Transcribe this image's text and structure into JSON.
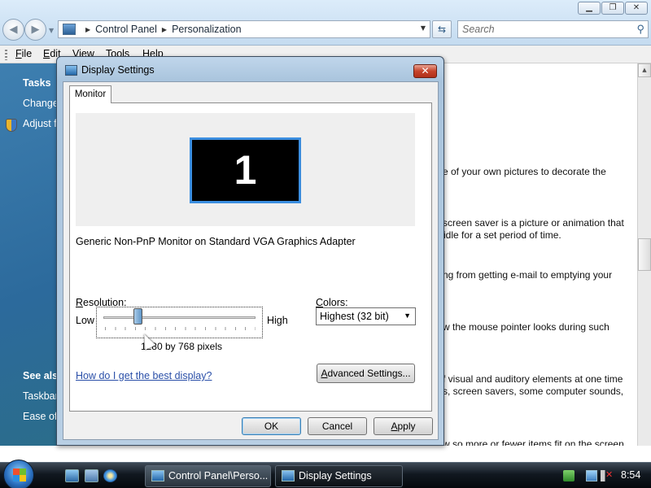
{
  "explorer": {
    "window_buttons": {
      "minimize": "▁",
      "maximize": "❐",
      "close": "✕"
    },
    "address": {
      "crumbs": [
        "Control Panel",
        "Personalization"
      ]
    },
    "search": {
      "placeholder": "Search"
    },
    "menu": {
      "file": "File",
      "edit": "Edit",
      "view": "View",
      "tools": "Tools",
      "help": "Help"
    },
    "task_pane": {
      "tasks_heading": "Tasks",
      "links": [
        "Change",
        "Adjust f"
      ],
      "see_also_heading": "See also",
      "see_also_links": [
        "Taskbar",
        "Ease of"
      ]
    },
    "content_lines": [
      "e of your own pictures to decorate the",
      "screen saver is a picture or animation that",
      "idle for a set period of time.",
      "ng from getting e-mail to emptying your",
      "w the mouse pointer looks during such",
      "f visual and auditory elements at one time",
      "s, screen savers, some computer sounds,",
      "w so more or fewer items fit on the screen"
    ]
  },
  "dialog": {
    "title": "Display Settings",
    "close_label": "✕",
    "tab_label": "Monitor",
    "monitor_number": "1",
    "monitor_name": "Generic Non-PnP Monitor on Standard VGA Graphics Adapter",
    "resolution_label": "Resolution:",
    "low_label": "Low",
    "high_label": "High",
    "resolution_value": "1280 by 768 pixels",
    "resolution_slider_level": 0.21,
    "colors_label": "Colors:",
    "colors_selected": "Highest (32 bit)",
    "help_link": "How do I get the best display?",
    "advanced_button": "Advanced Settings...",
    "ok_button": "OK",
    "cancel_button": "Cancel",
    "apply_button": "Apply"
  },
  "taskbar": {
    "tasks": [
      "Control Panel\\Perso...",
      "Display Settings"
    ],
    "clock": "8:54"
  },
  "colors": {
    "monitor_border": "#3b8ee0",
    "close_button": "#c6432a",
    "link": "#2a4fa8",
    "task_pane": "#2c6a9c"
  }
}
